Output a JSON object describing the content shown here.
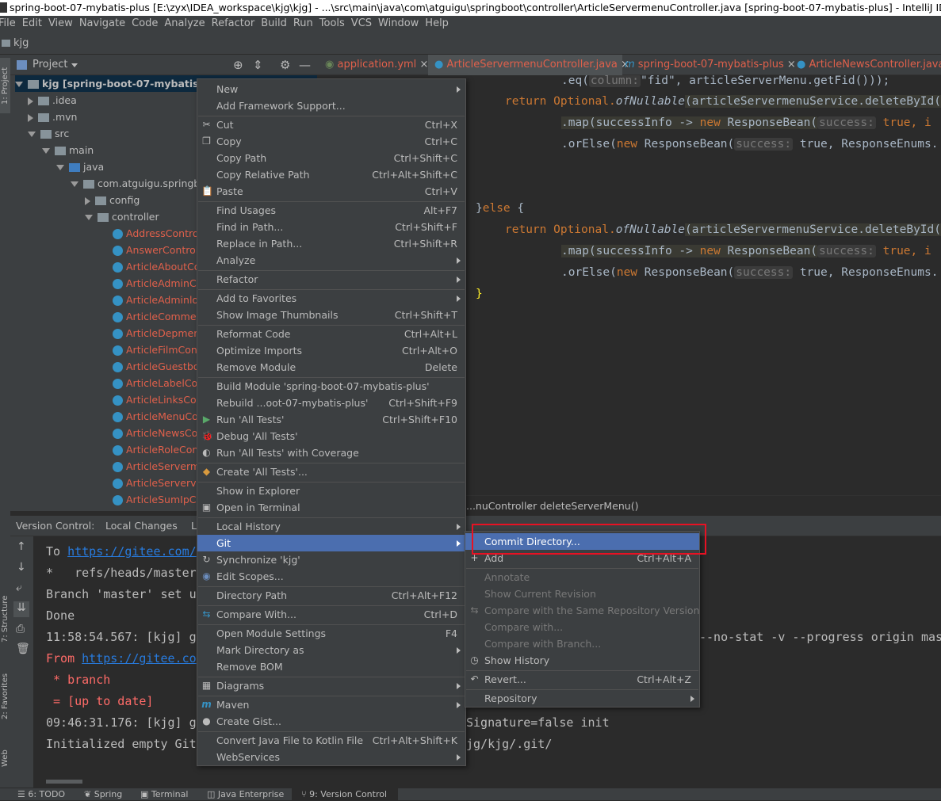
{
  "titlebar": {
    "text": "spring-boot-07-mybatis-plus [E:\\zyx\\IDEA_workspace\\kjg\\kjg] - ...\\src\\main\\java\\com\\atguigu\\springboot\\controller\\ArticleServermenuController.java [spring-boot-07-mybatis-plus] - IntelliJ IDEA (Administrator)"
  },
  "menubar": [
    "File",
    "Edit",
    "View",
    "Navigate",
    "Code",
    "Analyze",
    "Refactor",
    "Build",
    "Run",
    "Tools",
    "VCS",
    "Window",
    "Help"
  ],
  "navbar": {
    "project": "kjg"
  },
  "side_tabs": {
    "project": "1: Project",
    "structure": "7: Structure",
    "favorites": "2: Favorites",
    "web": "Web"
  },
  "project_panel": {
    "title": "Project",
    "tree": [
      {
        "label": "kjg [spring-boot-07-mybatis-plus]"
      },
      {
        "label": ".idea"
      },
      {
        "label": ".mvn"
      },
      {
        "label": "src"
      },
      {
        "label": "main"
      },
      {
        "label": "java"
      },
      {
        "label": "com.atguigu.springboot"
      },
      {
        "label": "config"
      },
      {
        "label": "controller"
      },
      {
        "label": "AddressController"
      },
      {
        "label": "AnswerController"
      },
      {
        "label": "ArticleAboutController"
      },
      {
        "label": "ArticleAdminController"
      },
      {
        "label": "ArticleAdminlogController"
      },
      {
        "label": "ArticleCommentController"
      },
      {
        "label": "ArticleDepmentController"
      },
      {
        "label": "ArticleFilmController"
      },
      {
        "label": "ArticleGuestbookController"
      },
      {
        "label": "ArticleLabelController"
      },
      {
        "label": "ArticleLinksController"
      },
      {
        "label": "ArticleMenuController"
      },
      {
        "label": "ArticleNewsController"
      },
      {
        "label": "ArticleRoleController"
      },
      {
        "label": "ArticleServermenuController"
      },
      {
        "label": "ArticleServervisController"
      },
      {
        "label": "ArticleSumIpController"
      }
    ]
  },
  "tabs": [
    {
      "label": "application.yml"
    },
    {
      "label": "ArticleServermenuController.java"
    },
    {
      "label": "spring-boot-07-mybatis-plus"
    },
    {
      "label": "ArticleNewsController.java"
    }
  ],
  "editor": {
    "lines": {
      "l1a": ".eq(",
      "l1p": "column:",
      "l1b": "\"fid\", articleServerMenu.getFid()));",
      "l2a": "return Optional.",
      "l2f": "ofNullable",
      "l2b": "(articleServermenuService.deleteById(",
      "l3a": ".map(successInfo -> ",
      "l3k": "new",
      "l3b": " ResponseBean(",
      "l3p": "success:",
      "l3c": " true, i",
      "l4a": ".orElse(",
      "l4k": "new",
      "l4b": " ResponseBean(",
      "l4p": "success:",
      "l4c": " true, ResponseEnums.",
      "l5a": "}",
      "l5k": "else",
      "l5b": " {",
      "l6a": "return Optional.",
      "l6f": "ofNullable",
      "l6b": "(articleServermenuService.deleteById(",
      "l7a": ".map(successInfo -> ",
      "l7k": "new",
      "l7b": " ResponseBean(",
      "l7p": "success:",
      "l7c": " true, i",
      "l8a": ".orElse(",
      "l8k": "new",
      "l8b": " ResponseBean(",
      "l8p": "success:",
      "l8c": " true, ResponseEnums.",
      "l9": "}"
    }
  },
  "breadcrumb": {
    "class": "...nuController",
    "method": "deleteServerMenu()"
  },
  "version_control": {
    "title": "Version Control:",
    "tab_local": "Local Changes",
    "tab_log": "L"
  },
  "console": {
    "c1a": "To ",
    "c1link": "https://gitee.com/",
    "c2": "*   refs/heads/master",
    "c3": "Branch 'master' set u",
    "c4": "Done",
    "c5a": "11:58:54.567: [kjg] g",
    "c5b": "--no-stat -v --progress origin mast",
    "c6a": "From ",
    "c6link": "https://gitee.co",
    "c7": " * branch",
    "c8": " = [up to date]",
    "c9a": "09:46:31.176: [kjg] g",
    "c9b": "Signature=false init",
    "c10a": "Initialized empty Git",
    "c10b": "jg/kjg/.git/"
  },
  "bottombar": [
    "6: TODO",
    "Spring",
    "Terminal",
    "Java Enterprise",
    "9: Version Control"
  ],
  "context_menu": {
    "items": [
      {
        "label": "New",
        "shortcut": "",
        "submenu": true
      },
      {
        "label": "Add Framework Support...",
        "shortcut": ""
      },
      {
        "label": "Cut",
        "shortcut": "Ctrl+X"
      },
      {
        "label": "Copy",
        "shortcut": "Ctrl+C"
      },
      {
        "label": "Copy Path",
        "shortcut": "Ctrl+Shift+C"
      },
      {
        "label": "Copy Relative Path",
        "shortcut": "Ctrl+Alt+Shift+C"
      },
      {
        "label": "Paste",
        "shortcut": "Ctrl+V"
      },
      {
        "label": "Find Usages",
        "shortcut": "Alt+F7"
      },
      {
        "label": "Find in Path...",
        "shortcut": "Ctrl+Shift+F"
      },
      {
        "label": "Replace in Path...",
        "shortcut": "Ctrl+Shift+R"
      },
      {
        "label": "Analyze",
        "shortcut": "",
        "submenu": true
      },
      {
        "label": "Refactor",
        "shortcut": "",
        "submenu": true
      },
      {
        "label": "Add to Favorites",
        "shortcut": "",
        "submenu": true
      },
      {
        "label": "Show Image Thumbnails",
        "shortcut": "Ctrl+Shift+T"
      },
      {
        "label": "Reformat Code",
        "shortcut": "Ctrl+Alt+L"
      },
      {
        "label": "Optimize Imports",
        "shortcut": "Ctrl+Alt+O"
      },
      {
        "label": "Remove Module",
        "shortcut": "Delete"
      },
      {
        "label": "Build Module 'spring-boot-07-mybatis-plus'",
        "shortcut": ""
      },
      {
        "label": "Rebuild ...oot-07-mybatis-plus'",
        "shortcut": "Ctrl+Shift+F9"
      },
      {
        "label": "Run 'All Tests'",
        "shortcut": "Ctrl+Shift+F10"
      },
      {
        "label": "Debug 'All Tests'",
        "shortcut": ""
      },
      {
        "label": "Run 'All Tests' with Coverage",
        "shortcut": ""
      },
      {
        "label": "Create 'All Tests'...",
        "shortcut": ""
      },
      {
        "label": "Show in Explorer",
        "shortcut": ""
      },
      {
        "label": "Open in Terminal",
        "shortcut": ""
      },
      {
        "label": "Local History",
        "shortcut": "",
        "submenu": true
      },
      {
        "label": "Git",
        "shortcut": "",
        "submenu": true
      },
      {
        "label": "Synchronize 'kjg'",
        "shortcut": ""
      },
      {
        "label": "Edit Scopes...",
        "shortcut": ""
      },
      {
        "label": "Directory Path",
        "shortcut": "Ctrl+Alt+F12"
      },
      {
        "label": "Compare With...",
        "shortcut": "Ctrl+D"
      },
      {
        "label": "Open Module Settings",
        "shortcut": "F4"
      },
      {
        "label": "Mark Directory as",
        "shortcut": "",
        "submenu": true
      },
      {
        "label": "Remove BOM",
        "shortcut": ""
      },
      {
        "label": "Diagrams",
        "shortcut": "",
        "submenu": true
      },
      {
        "label": "Maven",
        "shortcut": "",
        "submenu": true
      },
      {
        "label": "Create Gist...",
        "shortcut": ""
      },
      {
        "label": "Convert Java File to Kotlin File",
        "shortcut": "Ctrl+Alt+Shift+K"
      },
      {
        "label": "WebServices",
        "shortcut": "",
        "submenu": true
      }
    ]
  },
  "git_submenu": {
    "items": [
      {
        "label": "Commit Directory...",
        "shortcut": ""
      },
      {
        "label": "Add",
        "shortcut": "Ctrl+Alt+A"
      },
      {
        "label": "Annotate",
        "shortcut": ""
      },
      {
        "label": "Show Current Revision",
        "shortcut": ""
      },
      {
        "label": "Compare with the Same Repository Version",
        "shortcut": ""
      },
      {
        "label": "Compare with...",
        "shortcut": ""
      },
      {
        "label": "Compare with Branch...",
        "shortcut": ""
      },
      {
        "label": "Show History",
        "shortcut": ""
      },
      {
        "label": "Revert...",
        "shortcut": "Ctrl+Alt+Z"
      },
      {
        "label": "Repository",
        "shortcut": "",
        "submenu": true
      }
    ]
  },
  "colors": {
    "accent": "#4b6eaf",
    "highlight_box": "#e81123",
    "panel": "#3c3f41",
    "editor_bg": "#2b2b2b"
  }
}
